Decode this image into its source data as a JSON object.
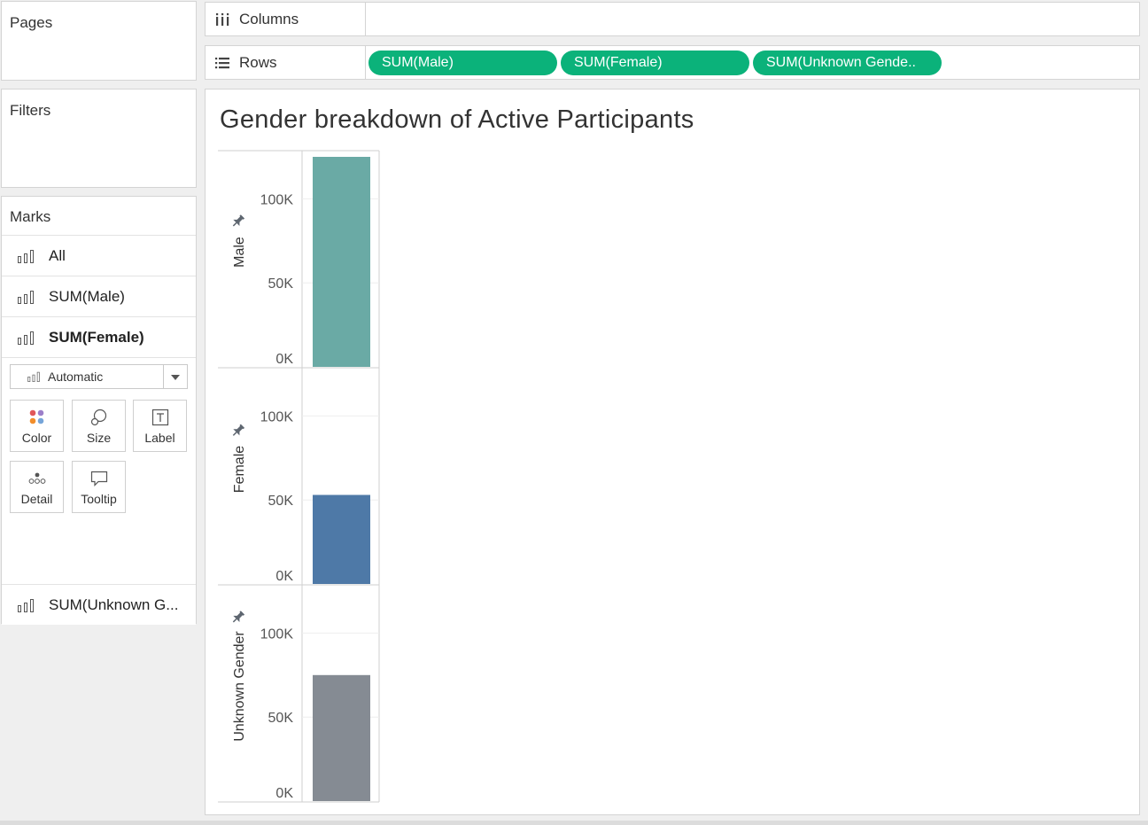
{
  "pages": {
    "title": "Pages"
  },
  "filters": {
    "title": "Filters"
  },
  "shelves": {
    "columns": {
      "label": "Columns",
      "icon": "columns-icon"
    },
    "rows": {
      "label": "Rows",
      "icon": "rows-icon",
      "pills": [
        "SUM(Male)",
        "SUM(Female)",
        "SUM(Unknown Gende.."
      ]
    }
  },
  "marks": {
    "title": "Marks",
    "cards": [
      "All",
      "SUM(Male)",
      "SUM(Female)"
    ],
    "selected_card": "SUM(Female)",
    "mark_type": "Automatic",
    "buttons": [
      "Color",
      "Size",
      "Label",
      "Detail",
      "Tooltip"
    ],
    "extra_card": "SUM(Unknown G..."
  },
  "colors": {
    "pill": "#0bb27a",
    "male": "#6aaaa5",
    "female": "#4e79a7",
    "unknown": "#858b93"
  },
  "chart_data": {
    "type": "bar",
    "title": "Gender breakdown of Active Participants",
    "panes": [
      {
        "name": "Male",
        "value": 125000,
        "color": "#6aaaa5"
      },
      {
        "name": "Female",
        "value": 53000,
        "color": "#4e79a7"
      },
      {
        "name": "Unknown Gender",
        "value": 75000,
        "color": "#858b93"
      }
    ],
    "ylim": [
      0,
      125000
    ],
    "yticks": [
      0,
      50000,
      100000
    ],
    "ytick_labels": [
      "0K",
      "50K",
      "100K"
    ],
    "grid": true
  }
}
